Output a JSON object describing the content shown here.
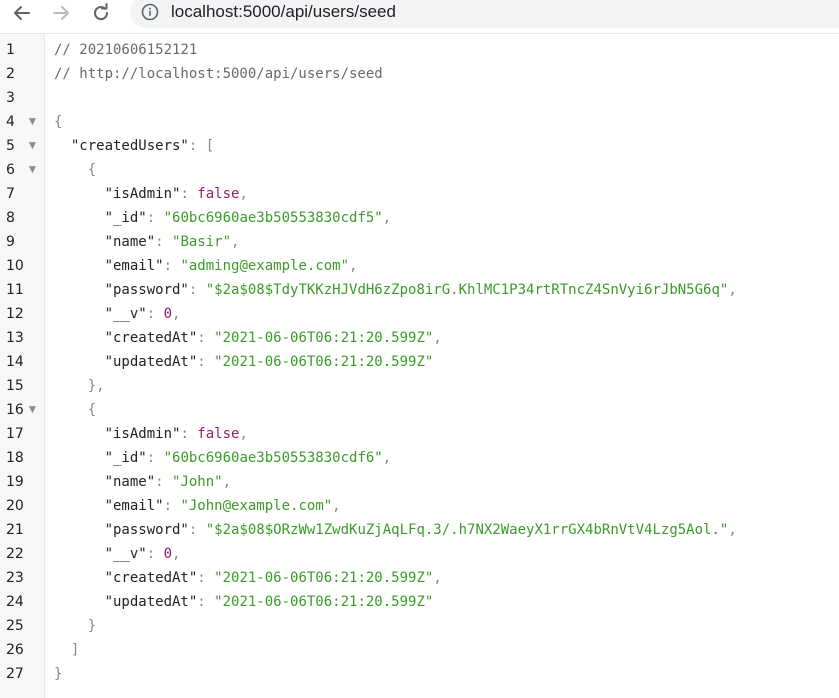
{
  "browser": {
    "url": "localhost:5000/api/users/seed",
    "back_icon": "arrow-left-icon",
    "forward_icon": "arrow-right-icon",
    "reload_icon": "reload-icon",
    "info_icon": "info-icon"
  },
  "viewer": {
    "lines": [
      {
        "n": "1",
        "fold": false,
        "parts": [
          [
            "c",
            "// 20210606152121"
          ]
        ]
      },
      {
        "n": "2",
        "fold": false,
        "parts": [
          [
            "c",
            "// http://localhost:5000/api/users/seed"
          ]
        ]
      },
      {
        "n": "3",
        "fold": false,
        "parts": []
      },
      {
        "n": "4",
        "fold": true,
        "parts": [
          [
            "p",
            "{"
          ]
        ]
      },
      {
        "n": "5",
        "fold": true,
        "parts": [
          [
            "t",
            "  "
          ],
          [
            "k",
            "\"createdUsers\""
          ],
          [
            "p",
            ": ["
          ]
        ]
      },
      {
        "n": "6",
        "fold": true,
        "parts": [
          [
            "t",
            "    "
          ],
          [
            "p",
            "{"
          ]
        ]
      },
      {
        "n": "7",
        "fold": false,
        "parts": [
          [
            "t",
            "      "
          ],
          [
            "k",
            "\"isAdmin\""
          ],
          [
            "p",
            ": "
          ],
          [
            "b",
            "false"
          ],
          [
            "p",
            ","
          ]
        ]
      },
      {
        "n": "8",
        "fold": false,
        "parts": [
          [
            "t",
            "      "
          ],
          [
            "k",
            "\"_id\""
          ],
          [
            "p",
            ": "
          ],
          [
            "s",
            "\"60bc6960ae3b50553830cdf5\""
          ],
          [
            "p",
            ","
          ]
        ]
      },
      {
        "n": "9",
        "fold": false,
        "parts": [
          [
            "t",
            "      "
          ],
          [
            "k",
            "\"name\""
          ],
          [
            "p",
            ": "
          ],
          [
            "s",
            "\"Basir\""
          ],
          [
            "p",
            ","
          ]
        ]
      },
      {
        "n": "10",
        "fold": false,
        "parts": [
          [
            "t",
            "      "
          ],
          [
            "k",
            "\"email\""
          ],
          [
            "p",
            ": "
          ],
          [
            "s",
            "\"adming@example.com\""
          ],
          [
            "p",
            ","
          ]
        ]
      },
      {
        "n": "11",
        "fold": false,
        "parts": [
          [
            "t",
            "      "
          ],
          [
            "k",
            "\"password\""
          ],
          [
            "p",
            ": "
          ],
          [
            "s",
            "\"$2a$08$TdyTKKzHJVdH6zZpo8irG.KhlMC1P34rtRTncZ4SnVyi6rJbN5G6q\""
          ],
          [
            "p",
            ","
          ]
        ]
      },
      {
        "n": "12",
        "fold": false,
        "parts": [
          [
            "t",
            "      "
          ],
          [
            "k",
            "\"__v\""
          ],
          [
            "p",
            ": "
          ],
          [
            "n",
            "0"
          ],
          [
            "p",
            ","
          ]
        ]
      },
      {
        "n": "13",
        "fold": false,
        "parts": [
          [
            "t",
            "      "
          ],
          [
            "k",
            "\"createdAt\""
          ],
          [
            "p",
            ": "
          ],
          [
            "s",
            "\"2021-06-06T06:21:20.599Z\""
          ],
          [
            "p",
            ","
          ]
        ]
      },
      {
        "n": "14",
        "fold": false,
        "parts": [
          [
            "t",
            "      "
          ],
          [
            "k",
            "\"updatedAt\""
          ],
          [
            "p",
            ": "
          ],
          [
            "s",
            "\"2021-06-06T06:21:20.599Z\""
          ]
        ]
      },
      {
        "n": "15",
        "fold": false,
        "parts": [
          [
            "t",
            "    "
          ],
          [
            "p",
            "},"
          ]
        ]
      },
      {
        "n": "16",
        "fold": true,
        "parts": [
          [
            "t",
            "    "
          ],
          [
            "p",
            "{"
          ]
        ]
      },
      {
        "n": "17",
        "fold": false,
        "parts": [
          [
            "t",
            "      "
          ],
          [
            "k",
            "\"isAdmin\""
          ],
          [
            "p",
            ": "
          ],
          [
            "b",
            "false"
          ],
          [
            "p",
            ","
          ]
        ]
      },
      {
        "n": "18",
        "fold": false,
        "parts": [
          [
            "t",
            "      "
          ],
          [
            "k",
            "\"_id\""
          ],
          [
            "p",
            ": "
          ],
          [
            "s",
            "\"60bc6960ae3b50553830cdf6\""
          ],
          [
            "p",
            ","
          ]
        ]
      },
      {
        "n": "19",
        "fold": false,
        "parts": [
          [
            "t",
            "      "
          ],
          [
            "k",
            "\"name\""
          ],
          [
            "p",
            ": "
          ],
          [
            "s",
            "\"John\""
          ],
          [
            "p",
            ","
          ]
        ]
      },
      {
        "n": "20",
        "fold": false,
        "parts": [
          [
            "t",
            "      "
          ],
          [
            "k",
            "\"email\""
          ],
          [
            "p",
            ": "
          ],
          [
            "s",
            "\"John@example.com\""
          ],
          [
            "p",
            ","
          ]
        ]
      },
      {
        "n": "21",
        "fold": false,
        "parts": [
          [
            "t",
            "      "
          ],
          [
            "k",
            "\"password\""
          ],
          [
            "p",
            ": "
          ],
          [
            "s",
            "\"$2a$08$ORzWw1ZwdKuZjAqLFq.3/.h7NX2WaeyX1rrGX4bRnVtV4Lzg5Aol.\""
          ],
          [
            "p",
            ","
          ]
        ]
      },
      {
        "n": "22",
        "fold": false,
        "parts": [
          [
            "t",
            "      "
          ],
          [
            "k",
            "\"__v\""
          ],
          [
            "p",
            ": "
          ],
          [
            "n",
            "0"
          ],
          [
            "p",
            ","
          ]
        ]
      },
      {
        "n": "23",
        "fold": false,
        "parts": [
          [
            "t",
            "      "
          ],
          [
            "k",
            "\"createdAt\""
          ],
          [
            "p",
            ": "
          ],
          [
            "s",
            "\"2021-06-06T06:21:20.599Z\""
          ],
          [
            "p",
            ","
          ]
        ]
      },
      {
        "n": "24",
        "fold": false,
        "parts": [
          [
            "t",
            "      "
          ],
          [
            "k",
            "\"updatedAt\""
          ],
          [
            "p",
            ": "
          ],
          [
            "s",
            "\"2021-06-06T06:21:20.599Z\""
          ]
        ]
      },
      {
        "n": "25",
        "fold": false,
        "parts": [
          [
            "t",
            "    "
          ],
          [
            "p",
            "}"
          ]
        ]
      },
      {
        "n": "26",
        "fold": false,
        "parts": [
          [
            "t",
            "  "
          ],
          [
            "p",
            "]"
          ]
        ]
      },
      {
        "n": "27",
        "fold": false,
        "parts": [
          [
            "p",
            "}"
          ]
        ]
      }
    ]
  },
  "colors": {
    "key": "#222222",
    "string": "#3c9a2a",
    "literal": "#9a1c6f",
    "comment": "#6a6a6a",
    "punctuation": "#888888"
  }
}
